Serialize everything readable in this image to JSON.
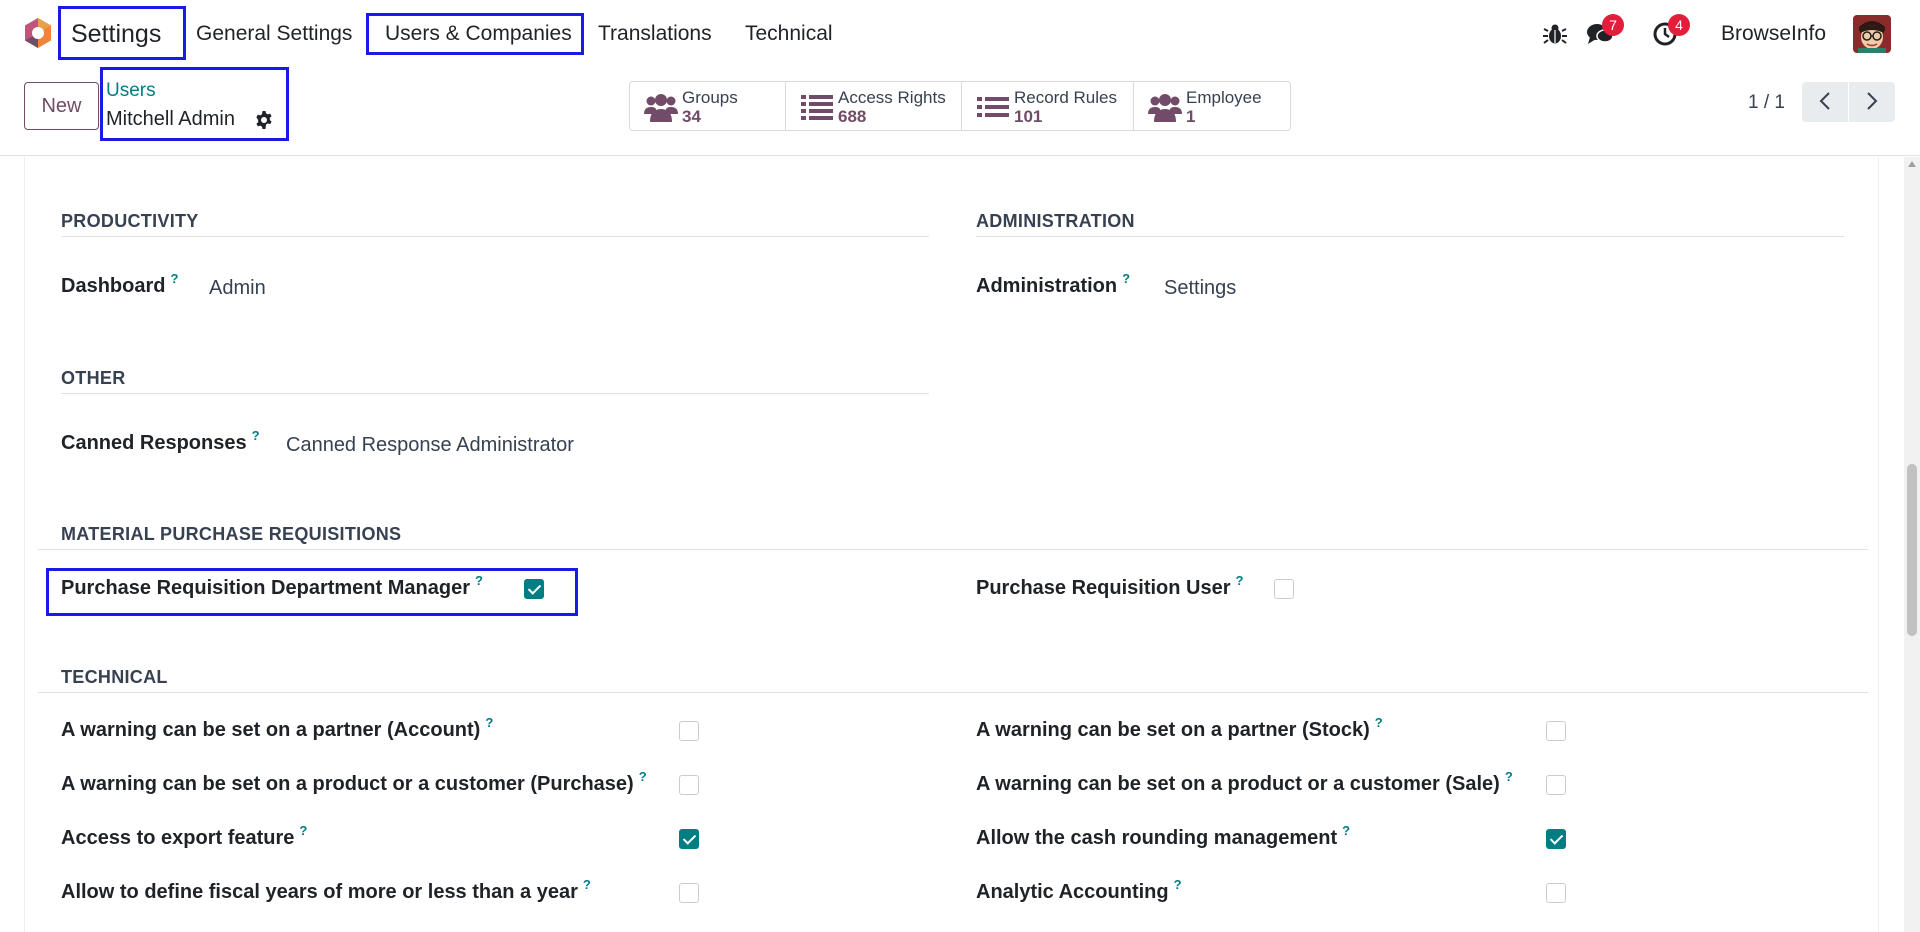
{
  "nav": {
    "app_name": "Settings",
    "menu": [
      "General Settings",
      "Users & Companies",
      "Translations",
      "Technical"
    ],
    "messages_badge": "7",
    "activities_badge": "4",
    "user_name": "BrowseInfo"
  },
  "control": {
    "new_label": "New",
    "breadcrumb_parent": "Users",
    "breadcrumb_current": "Mitchell Admin",
    "pager": "1 / 1",
    "smart_buttons": [
      {
        "label": "Groups",
        "value": "34",
        "icon": "users-icon"
      },
      {
        "label": "Access Rights",
        "value": "688",
        "icon": "list-icon"
      },
      {
        "label": "Record Rules",
        "value": "101",
        "icon": "list-icon"
      },
      {
        "label": "Employee",
        "value": "1",
        "icon": "users-icon"
      }
    ]
  },
  "sections": {
    "productivity": {
      "title": "PRODUCTIVITY",
      "field_label": "Dashboard",
      "field_value": "Admin"
    },
    "administration": {
      "title": "ADMINISTRATION",
      "field_label": "Administration",
      "field_value": "Settings"
    },
    "other": {
      "title": "OTHER",
      "field_label": "Canned Responses",
      "field_value": "Canned Response Administrator"
    },
    "material": {
      "title": "MATERIAL PURCHASE REQUISITIONS",
      "left_label": "Purchase Requisition Department Manager",
      "left_checked": true,
      "right_label": "Purchase Requisition User",
      "right_checked": false
    },
    "technical": {
      "title": "TECHNICAL",
      "rows": [
        {
          "left": "A warning can be set on a partner (Account)",
          "left_checked": false,
          "right": "A warning can be set on a partner (Stock)",
          "right_checked": false
        },
        {
          "left": "A warning can be set on a product or a customer (Purchase)",
          "left_checked": false,
          "right": "A warning can be set on a product or a customer (Sale)",
          "right_checked": false
        },
        {
          "left": "Access to export feature",
          "left_checked": true,
          "right": "Allow the cash rounding management",
          "right_checked": true
        },
        {
          "left": "Allow to define fiscal years of more or less than a year",
          "left_checked": false,
          "right": "Analytic Accounting",
          "right_checked": false
        }
      ]
    }
  },
  "help_mark": "?",
  "colors": {
    "brand": "#714b67",
    "accent": "#017e84",
    "badge": "#e31e3b",
    "highlight": "#1a1ae6"
  }
}
